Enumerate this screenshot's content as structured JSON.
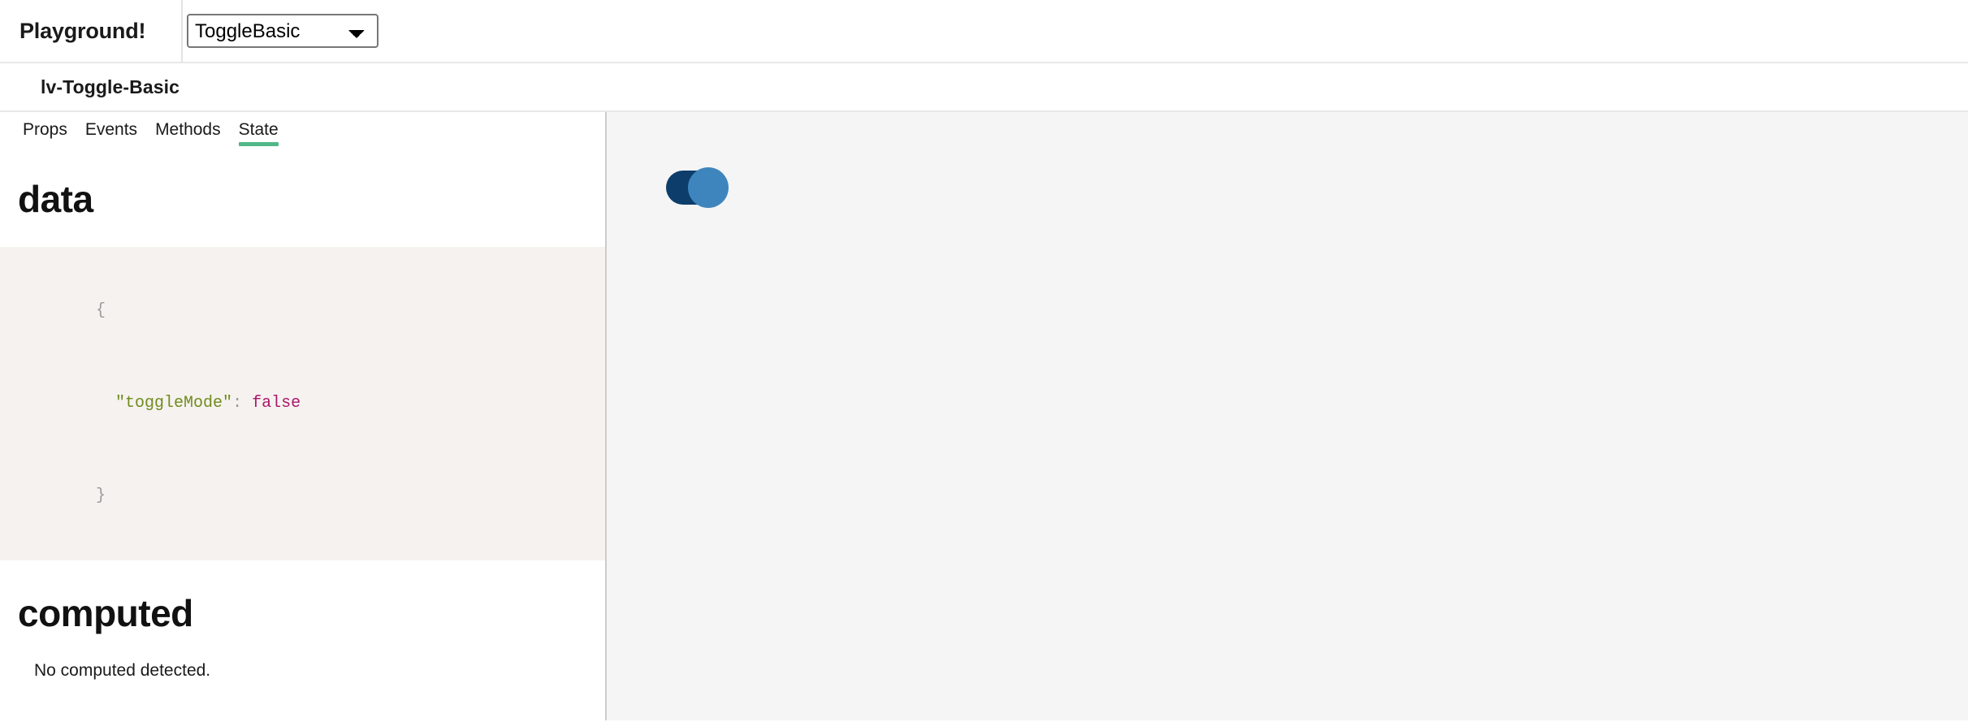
{
  "header": {
    "title": "Playground!",
    "component_select": {
      "selected": "ToggleBasic",
      "options": [
        "ToggleBasic"
      ],
      "chevron_icon": "chevron-down-icon"
    }
  },
  "subtitle": {
    "text": "lv-Toggle-Basic"
  },
  "tabs": [
    {
      "label": "Props",
      "active": false
    },
    {
      "label": "Events",
      "active": false
    },
    {
      "label": "Methods",
      "active": false
    },
    {
      "label": "State",
      "active": true
    }
  ],
  "sections": {
    "data": {
      "heading": "data",
      "code": {
        "open_brace": "{",
        "key": "\"toggleMode\"",
        "colon": ":",
        "value": "false",
        "close_brace": "}"
      }
    },
    "computed": {
      "heading": "computed",
      "empty_message": "No computed detected."
    }
  },
  "preview": {
    "toggle": {
      "name": "toggle-switch",
      "state": "on-position-right",
      "track_color": "#0d3d6b",
      "knob_color": "#3e85bd"
    }
  },
  "colors": {
    "accent_tab_underline": "#52b788",
    "code_background": "#f6f2ef",
    "preview_background": "#f5f5f5",
    "panel_divider": "#cccccc",
    "json_key": "#6f8c1e",
    "json_boolean": "#a9186b"
  }
}
